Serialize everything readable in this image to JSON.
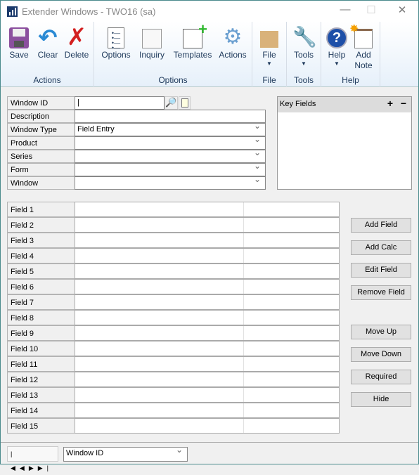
{
  "window": {
    "title": "Extender Windows  -  TWO16 (sa)"
  },
  "ribbon": {
    "groups": [
      {
        "label": "Actions",
        "buttons": [
          {
            "label": "Save",
            "icon": "save-icon"
          },
          {
            "label": "Clear",
            "icon": "undo-icon"
          },
          {
            "label": "Delete",
            "icon": "delete-icon"
          }
        ]
      },
      {
        "label": "Options",
        "buttons": [
          {
            "label": "Options",
            "icon": "options-icon"
          },
          {
            "label": "Inquiry",
            "icon": "inquiry-icon"
          },
          {
            "label": "Templates",
            "icon": "templates-icon"
          },
          {
            "label": "Actions",
            "icon": "gears-icon"
          }
        ]
      },
      {
        "label": "File",
        "buttons": [
          {
            "label": "File",
            "icon": "folder-icon"
          }
        ]
      },
      {
        "label": "Tools",
        "buttons": [
          {
            "label": "Tools",
            "icon": "tools-icon"
          }
        ]
      },
      {
        "label": "Help",
        "buttons": [
          {
            "label": "Help",
            "icon": "help-icon"
          },
          {
            "label": "Add",
            "label2": "Note",
            "icon": "note-icon"
          }
        ]
      }
    ]
  },
  "form": {
    "labels": [
      "Window ID",
      "Description",
      "Window Type",
      "Product",
      "Series",
      "Form",
      "Window"
    ],
    "window_id": "|",
    "description": "",
    "window_type": "Field Entry",
    "product": "",
    "series": "",
    "form": "",
    "window": ""
  },
  "key_fields": {
    "title": "Key Fields",
    "add": "+",
    "remove": "−"
  },
  "fields": [
    "Field 1",
    "Field 2",
    "Field 3",
    "Field 4",
    "Field 5",
    "Field 6",
    "Field 7",
    "Field 8",
    "Field 9",
    "Field 10",
    "Field 11",
    "Field 12",
    "Field 13",
    "Field 14",
    "Field 15"
  ],
  "buttons": [
    "Add Field",
    "Add Calc",
    "Edit Field",
    "Remove Field",
    "Move Up",
    "Move Down",
    "Required",
    "Hide"
  ],
  "footer": {
    "sort_by": "Window ID",
    "nav": [
      "first",
      "previous",
      "next",
      "last"
    ]
  }
}
